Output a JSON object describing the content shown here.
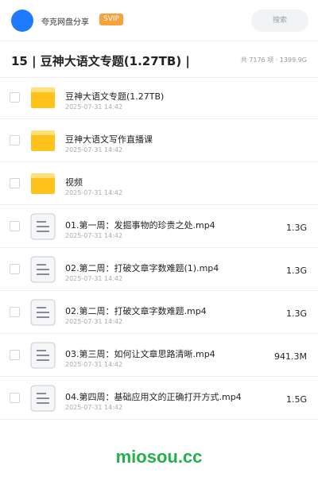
{
  "header": {
    "app_name": "夸克网盘分享",
    "badge": "SVIP",
    "search_placeholder": "搜索"
  },
  "folder": {
    "title": "15 | 豆神大语文专题(1.27TB) |",
    "summary": "共 7176 项 · 1399.9G"
  },
  "files": [
    {
      "type": "folder-icon",
      "name": "豆神大语文专题(1.27TB)",
      "date": "2025-07-31 14:42",
      "size": ""
    },
    {
      "type": "folder-icon",
      "name": "豆神大语文写作直播课",
      "date": "2025-07-31 14:42",
      "size": ""
    },
    {
      "type": "folder-icon",
      "name": "视频",
      "date": "2025-07-31 14:42",
      "size": ""
    },
    {
      "type": "document-icon",
      "name": "01.第一周：发掘事物的珍贵之处.mp4",
      "date": "2025-07-31 14:42",
      "size": "1.3G"
    },
    {
      "type": "document-icon",
      "name": "02.第二周：打破文章字数难题(1).mp4",
      "date": "2025-07-31 14:42",
      "size": "1.3G"
    },
    {
      "type": "document-icon",
      "name": "02.第二周：打破文章字数难题.mp4",
      "date": "2025-07-31 14:42",
      "size": "1.3G"
    },
    {
      "type": "document-icon",
      "name": "03.第三周：如何让文章思路清晰.mp4",
      "date": "2025-07-31 14:42",
      "size": "941.3M"
    },
    {
      "type": "document-icon",
      "name": "04.第四周：基础应用文的正确打开方式.mp4",
      "date": "2025-07-31 14:42",
      "size": "1.5G"
    }
  ],
  "footer": {
    "brand": "miosou.cc"
  },
  "colors": {
    "avatar": "#1e7bff",
    "badge": "#f7a23b",
    "folder": "#ffc21a",
    "brand": "#22b04b"
  }
}
